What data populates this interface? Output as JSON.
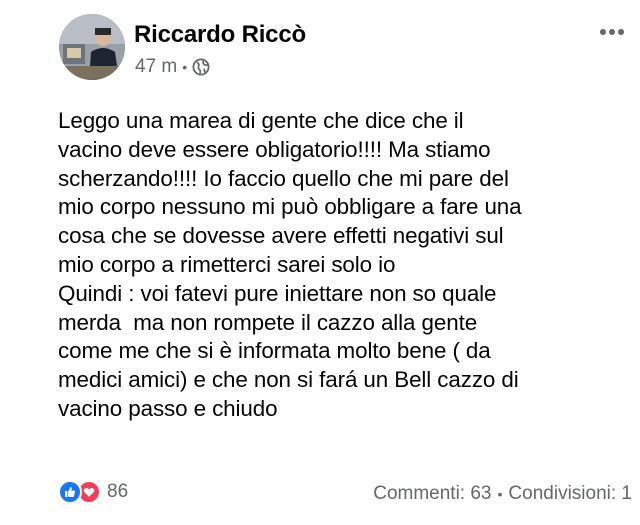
{
  "post": {
    "author": "Riccardo Riccò",
    "time": "47 m",
    "meta_separator": "•",
    "audience_icon": "globe-icon",
    "more_icon": "more-dots-icon",
    "text": "Leggo una marea di gente che dice che il\nvacino deve essere obligatorio!!!! Ma stiamo\nscherzando!!!! Io faccio quello che mi pare del\nmio corpo nessuno mi può obbligare a fare una\ncosa che se dovesse avere effetti negativi sul\nmio corpo a rimetterci sarei solo io\nQuindi : voi fatevi pure iniettare non so quale\nmerda  ma non rompete il cazzo alla gente\ncome me che si è informata molto bene ( da\nmedici amici) e che non si fará un Bell cazzo di\nvacino passo e chiudo"
  },
  "footer": {
    "reaction_icons": [
      "like-icon",
      "love-icon"
    ],
    "reaction_count": "86",
    "comments": "Commenti: 63",
    "separator": "•",
    "shares": "Condivisioni: 1"
  },
  "colors": {
    "text": "#050505",
    "secondary": "#65676b",
    "like": "#1877f2",
    "love": "#f33e58"
  }
}
